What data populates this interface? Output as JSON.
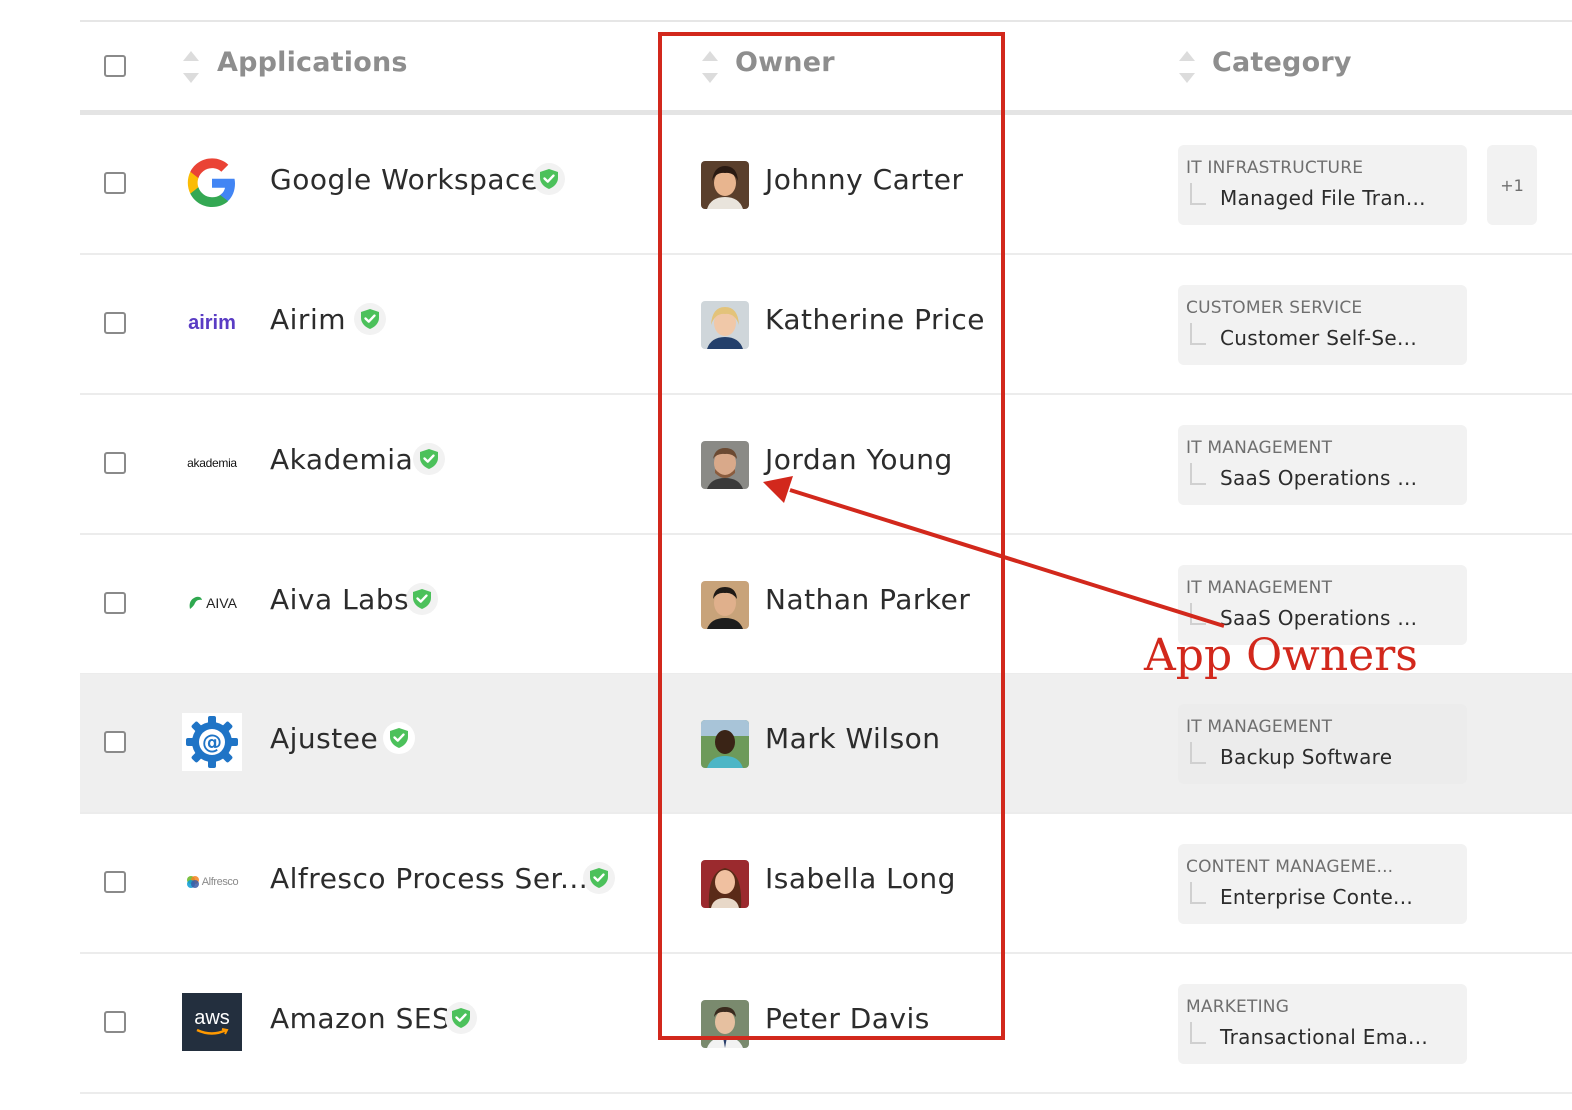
{
  "header": {
    "applications": "Applications",
    "owner": "Owner",
    "category": "Category"
  },
  "rows": [
    {
      "app": "Google Workspace",
      "owner": "Johnny Carter",
      "category": "IT INFRASTRUCTURE",
      "subcategory": "Managed File Tran...",
      "extra": "+1"
    },
    {
      "app": "Airim",
      "logo_text": "airim",
      "owner": "Katherine Price",
      "category": "CUSTOMER SERVICE",
      "subcategory": "Customer Self-Se..."
    },
    {
      "app": "Akademia",
      "logo_text": "akademia",
      "owner": "Jordan Young",
      "category": "IT MANAGEMENT",
      "subcategory": "SaaS Operations ..."
    },
    {
      "app": "Aiva Labs",
      "logo_text": "AIVA",
      "owner": "Nathan Parker",
      "category": "IT MANAGEMENT",
      "subcategory": "SaaS Operations ..."
    },
    {
      "app": "Ajustee",
      "owner": "Mark Wilson",
      "category": "IT MANAGEMENT",
      "subcategory": "Backup Software"
    },
    {
      "app": "Alfresco Process Ser...",
      "logo_text": "Alfresco",
      "owner": "Isabella Long",
      "category": "CONTENT MANAGEME...",
      "subcategory": "Enterprise Conte..."
    },
    {
      "app": "Amazon SES",
      "logo_text": "aws",
      "owner": "Peter Davis",
      "category": "MARKETING",
      "subcategory": "Transactional Ema..."
    }
  ],
  "annotation": {
    "label": "App Owners",
    "color": "#d2281c"
  },
  "colors": {
    "verified": "#4cc15b",
    "highlight_row": "#efefef"
  }
}
